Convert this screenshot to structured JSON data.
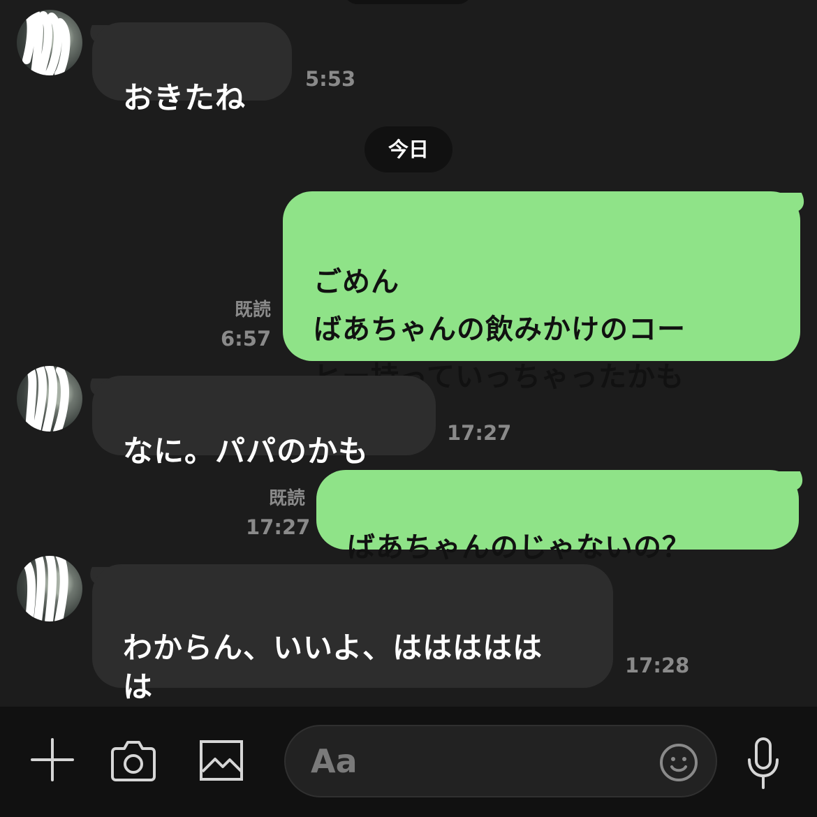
{
  "messages": [
    {
      "id": "m1",
      "direction": "incoming",
      "text": "おきたね",
      "time": "5:53"
    },
    {
      "id": "m2",
      "direction": "outgoing",
      "text": "ごめん\nばあちゃんの飲みかけのコー\nヒー持っていっちゃったかも",
      "read": "既読",
      "time": "6:57"
    },
    {
      "id": "m3",
      "direction": "incoming",
      "text": "なに。パパのかも",
      "time": "17:27"
    },
    {
      "id": "m4",
      "direction": "outgoing",
      "text": "ばあちゃんのじゃないの？",
      "read": "既読",
      "time": "17:27"
    },
    {
      "id": "m5",
      "direction": "incoming",
      "text": "わからん、いいよ、ははははは\nは",
      "time": "17:28"
    }
  ],
  "date_separator": "今日",
  "composer": {
    "placeholder": "Aa",
    "icons": [
      "plus-icon",
      "camera-icon",
      "image-icon",
      "emoji-icon",
      "microphone-icon"
    ]
  },
  "colors": {
    "background": "#1c1c1c",
    "incoming_bubble": "#2d2d2d",
    "outgoing_bubble": "#8fe388",
    "timestamp": "#8a8a8a",
    "composer": "#111111"
  }
}
